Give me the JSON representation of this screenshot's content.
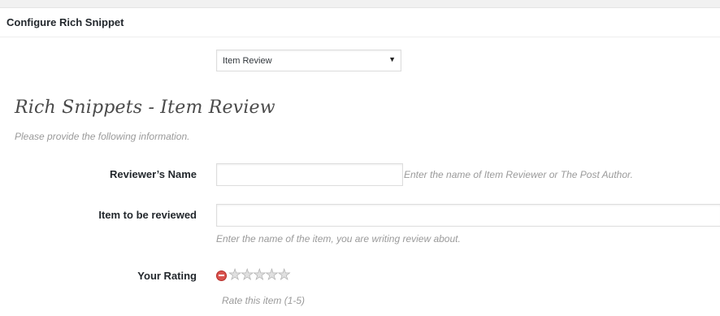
{
  "panel": {
    "title": "Configure Rich Snippet"
  },
  "type_select": {
    "selected": "Item Review"
  },
  "section": {
    "title": "Rich Snippets - Item Review",
    "description": "Please provide the following information."
  },
  "fields": {
    "reviewer_name": {
      "label": "Reviewer’s Name",
      "value": "",
      "hint": "Enter the name of Item Reviewer or The Post Author."
    },
    "item_name": {
      "label": "Item to be reviewed",
      "value": "",
      "hint": "Enter the name of the item, you are writing review about."
    },
    "rating": {
      "label": "Your Rating",
      "value": 0,
      "max": 5,
      "hint": "Rate this item (1-5)"
    }
  },
  "icons": {
    "select_arrow": "triangle-down-icon",
    "rating_cancel": "cancel-icon",
    "rating_star": "star-icon"
  },
  "colors": {
    "cancel_red": "#d9534f",
    "star_empty": "#e0e0e0"
  }
}
